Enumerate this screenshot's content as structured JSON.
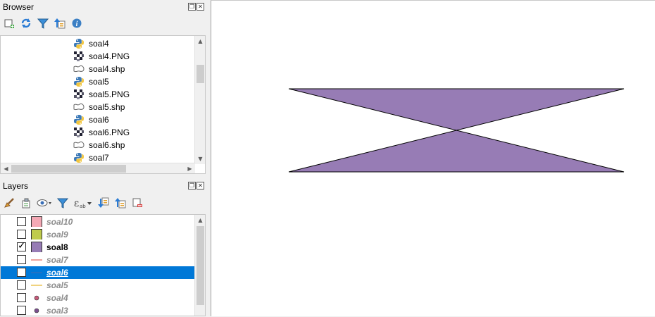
{
  "browser": {
    "title": "Browser",
    "toolbar_icons": [
      "add-layer-icon",
      "refresh-icon",
      "filter-icon",
      "collapse-all-icon",
      "info-icon"
    ],
    "items": [
      {
        "label": "soal4",
        "icon": "python-icon"
      },
      {
        "label": "soal4.PNG",
        "icon": "raster-icon"
      },
      {
        "label": "soal4.shp",
        "icon": "vector-icon"
      },
      {
        "label": "soal5",
        "icon": "python-icon"
      },
      {
        "label": "soal5.PNG",
        "icon": "raster-icon"
      },
      {
        "label": "soal5.shp",
        "icon": "vector-icon"
      },
      {
        "label": "soal6",
        "icon": "python-icon"
      },
      {
        "label": "soal6.PNG",
        "icon": "raster-icon"
      },
      {
        "label": "soal6.shp",
        "icon": "vector-icon"
      },
      {
        "label": "soal7",
        "icon": "python-icon"
      }
    ]
  },
  "layers": {
    "title": "Layers",
    "toolbar_icons": [
      "style-brush-icon",
      "add-group-icon",
      "eye-icon",
      "filter-icon",
      "expression-icon",
      "expand-all-icon",
      "collapse-all-icon",
      "remove-layer-icon"
    ],
    "items": [
      {
        "label": "soal10",
        "checked": false,
        "symbol": "fill",
        "color": "#f4a9b5",
        "selected": false
      },
      {
        "label": "soal9",
        "checked": false,
        "symbol": "fill",
        "color": "#bfcb4b",
        "selected": false
      },
      {
        "label": "soal8",
        "checked": true,
        "symbol": "fill",
        "color": "#977cb5",
        "selected": false
      },
      {
        "label": "soal7",
        "checked": false,
        "symbol": "line",
        "color": "#e0645a",
        "selected": false
      },
      {
        "label": "soal6",
        "checked": false,
        "symbol": "line",
        "color": "#3a6fb7",
        "selected": true
      },
      {
        "label": "soal5",
        "checked": false,
        "symbol": "line",
        "color": "#e7b62c",
        "selected": false
      },
      {
        "label": "soal4",
        "checked": false,
        "symbol": "point",
        "color": "#c75a7a",
        "selected": false
      },
      {
        "label": "soal3",
        "checked": false,
        "symbol": "point",
        "color": "#7b4f8f",
        "selected": false
      }
    ]
  },
  "map": {
    "fill_color": "#977cb5",
    "stroke_color": "#000000"
  }
}
